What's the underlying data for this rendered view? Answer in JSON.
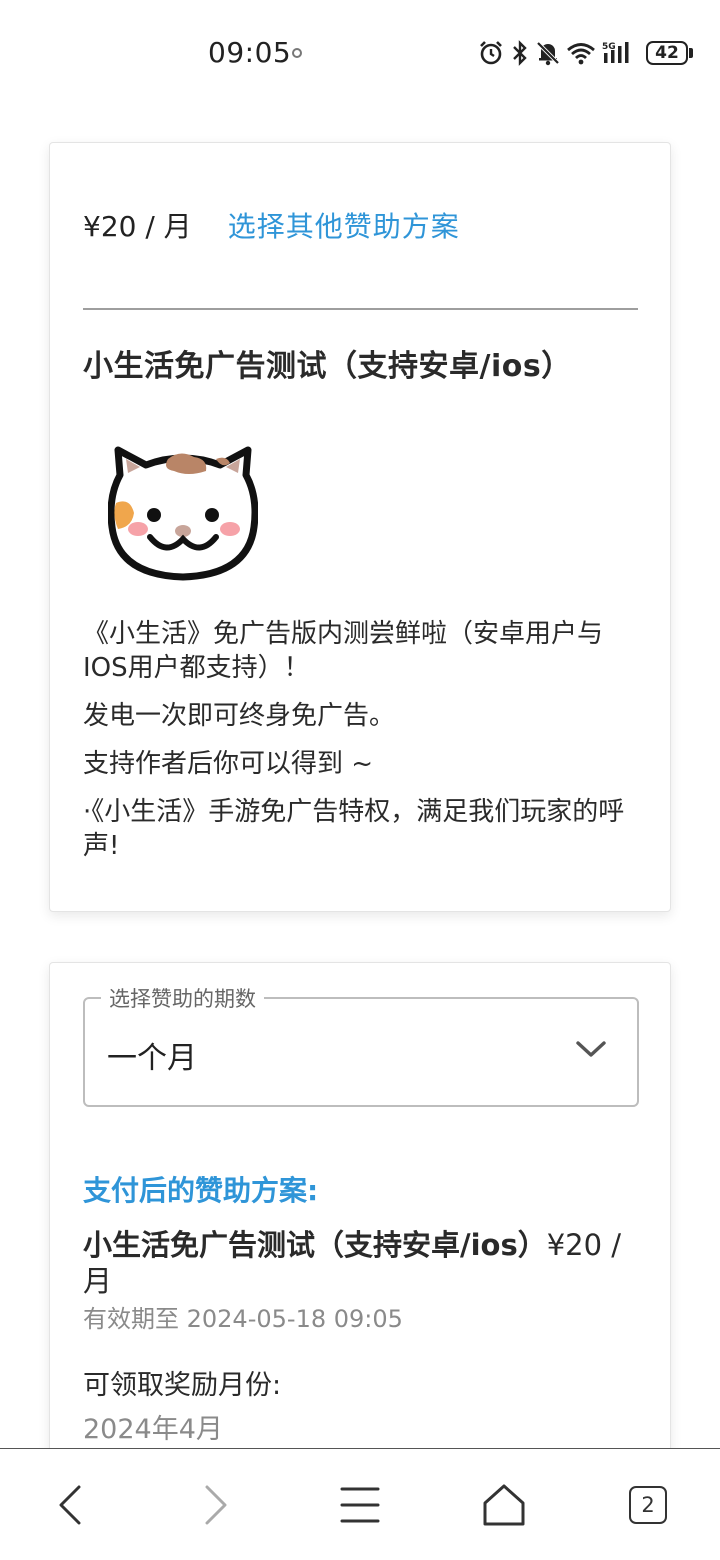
{
  "status_bar": {
    "time": "09:05",
    "battery": "42",
    "network": "5G",
    "icons": [
      "alarm-icon",
      "bluetooth-icon",
      "bell-muted-icon",
      "wifi-icon",
      "signal-icon",
      "battery-icon"
    ]
  },
  "plan_card": {
    "price": "¥20 / 月",
    "other_plans_link": "选择其他赞助方案",
    "title": "小生活免广告测试（支持安卓/ios）",
    "description": [
      "《小生活》免广告版内测尝鲜啦（安卓用户与IOS用户都支持）！",
      "发电一次即可终身免广告。",
      "支持作者后你可以得到 ~",
      "·《小生活》手游免广告特权，满足我们玩家的呼声!"
    ]
  },
  "order_card": {
    "period_label": "选择赞助的期数",
    "period_value": "一个月",
    "after_pay_heading": "支付后的赞助方案:",
    "after_pay_plan_name": "小生活免广告测试（支持安卓/ios）",
    "after_pay_plan_price": "¥20 / 月",
    "valid_until": "有效期至 2024-05-18 09:05",
    "reward_label": "可领取奖励月份:",
    "reward_month": "2024年4月"
  },
  "bottom_nav": {
    "tab_count": "2",
    "items": [
      "back-icon",
      "forward-icon",
      "menu-icon",
      "home-icon",
      "tabs-icon"
    ]
  },
  "colors": {
    "accent": "#2f95d8",
    "text": "#2a2a2a",
    "muted": "#8a8a8a"
  }
}
